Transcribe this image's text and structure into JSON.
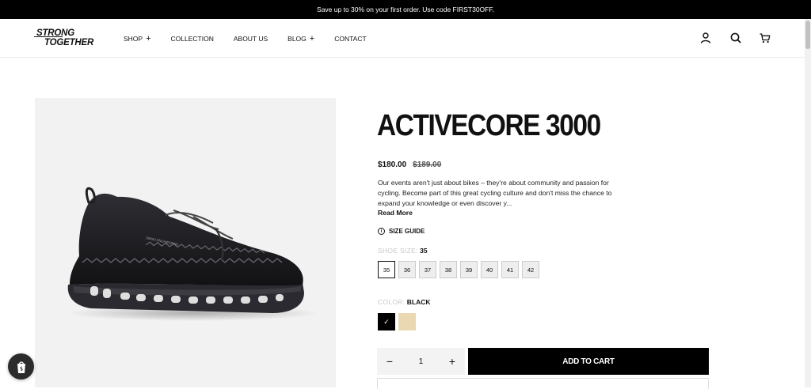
{
  "announcement": "Save up to 30% on your first order. Use code FIRST30OFF.",
  "logo": {
    "line1": "STRONG",
    "line2": "TOGETHER"
  },
  "nav": [
    {
      "label": "SHOP",
      "plus": "+"
    },
    {
      "label": "COLLECTION",
      "plus": ""
    },
    {
      "label": "ABOUT US",
      "plus": ""
    },
    {
      "label": "BLOG",
      "plus": "+"
    },
    {
      "label": "CONTACT",
      "plus": ""
    }
  ],
  "header_icons": [
    "account-icon",
    "search-icon",
    "cart-icon"
  ],
  "product": {
    "title": "ACTIVECORE 3000",
    "price": "$180.00",
    "compare_price": "$189.00",
    "description": "Our events aren't just about bikes – they're about community and passion for cycling. Become part of this great cycling culture and don't miss the chance to expand your knowledge or even discover y...",
    "read_more": "Read More",
    "size_guide": "SIZE GUIDE",
    "size_label": "SHOE SIZE:",
    "selected_size": "35",
    "sizes": [
      "35",
      "36",
      "37",
      "38",
      "39",
      "40",
      "41",
      "42"
    ],
    "color_label": "COLOR:",
    "selected_color": "BLACK",
    "colors": [
      {
        "name": "black",
        "hex": "#000000",
        "selected": true,
        "check": "✓"
      },
      {
        "name": "cream",
        "hex": "#ead8b3",
        "selected": false,
        "check": ""
      }
    ],
    "quantity": "1",
    "minus": "−",
    "plus": "+",
    "add_to_cart": "ADD TO CART"
  }
}
